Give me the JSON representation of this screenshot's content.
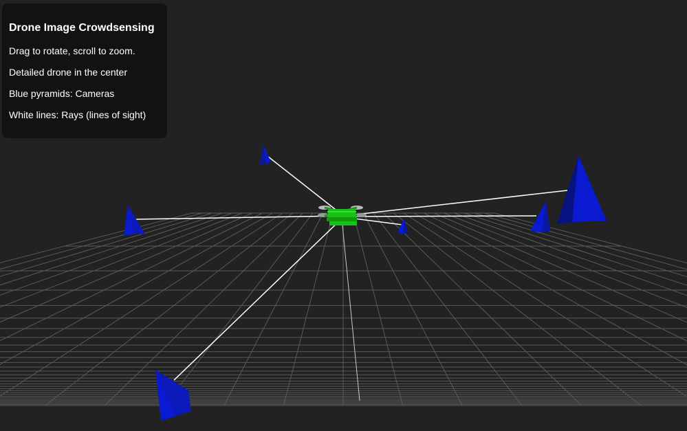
{
  "panel": {
    "title": "Drone Image Crowdsensing",
    "lines": [
      "Drag to rotate, scroll to zoom.",
      "Detailed drone in the center",
      "Blue pyramids: Cameras",
      "White lines: Rays (lines of sight)"
    ]
  },
  "scene": {
    "background_color": "#222222",
    "grid_color": "#5a5a5a",
    "drone_color": "#19c219",
    "camera_color": "#0a1ad0",
    "ray_color": "#ffffff",
    "camera_count": 6,
    "drone_icon": "drone-icon",
    "camera_icon": "pyramid-icon"
  }
}
